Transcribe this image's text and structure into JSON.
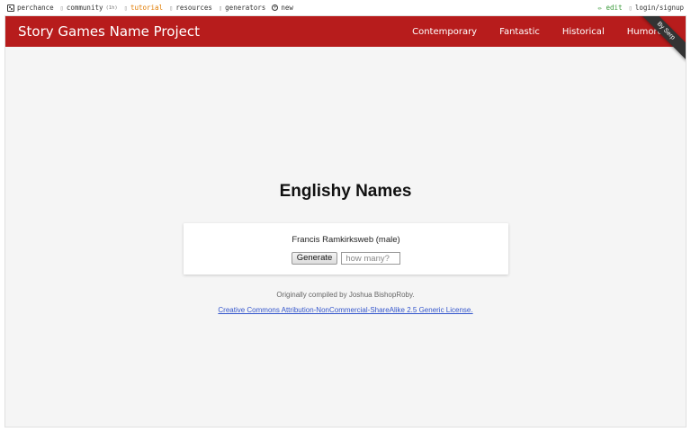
{
  "topbar": {
    "brand": "perchance",
    "community": "community",
    "community_count": "(1h)",
    "tutorial": "tutorial",
    "resources": "resources",
    "generators": "generators",
    "new": "new",
    "edit": "✏ edit",
    "login": "login/signup"
  },
  "navbar": {
    "brand": "Story Games Name Project",
    "links": [
      "Contemporary",
      "Fantastic",
      "Historical",
      "Humorous"
    ]
  },
  "ribbon": "By Serp",
  "main": {
    "title": "Englishy Names",
    "output": "Francis Ramkirksweb (male)",
    "generate_label": "Generate",
    "count_placeholder": "how many?",
    "credit": "Originally compiled by Joshua BishopRoby.",
    "license": "Creative Commons Attribution-NonCommercial-ShareAlike 2.5 Generic License."
  },
  "colors": {
    "navbar": "#b71c1c",
    "background": "#f5f5f5",
    "tutorial": "#e07b00",
    "edit": "#3a9a3a",
    "link": "#3355cc"
  }
}
